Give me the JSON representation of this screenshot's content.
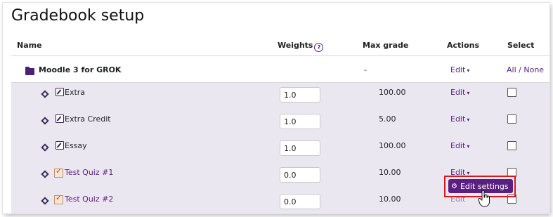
{
  "page": {
    "title": "Gradebook setup"
  },
  "headers": {
    "name": "Name",
    "weights": "Weights",
    "max_grade": "Max grade",
    "actions": "Actions",
    "select": "Select"
  },
  "category": {
    "name": "Moodle 3 for GROK",
    "max_grade": "-",
    "edit_label": "Edit",
    "select_all": "All",
    "select_sep": "/",
    "select_none": "None"
  },
  "items": [
    {
      "name": "Extra",
      "weight": "1.0",
      "max_grade": "100.00",
      "edit_label": "Edit",
      "icon": "edit-icon"
    },
    {
      "name": "Extra Credit",
      "weight": "1.0",
      "max_grade": "5.00",
      "edit_label": "Edit",
      "icon": "edit-icon"
    },
    {
      "name": "Essay",
      "weight": "1.0",
      "max_grade": "100.00",
      "edit_label": "Edit",
      "icon": "edit-icon"
    },
    {
      "name": "Test Quiz #1",
      "weight": "0.0",
      "max_grade": "10.00",
      "edit_label": "Edit",
      "icon": "quiz-icon"
    },
    {
      "name": "Test Quiz #2",
      "weight": "0.0",
      "max_grade": "10.00",
      "edit_label": "Edit",
      "icon": "quiz-icon"
    }
  ],
  "popup": {
    "label": "Edit settings",
    "icon": "gear-icon"
  },
  "colors": {
    "accent": "#5b1f82",
    "highlight": "#d7191f",
    "row_bg": "#ebe7f0"
  }
}
